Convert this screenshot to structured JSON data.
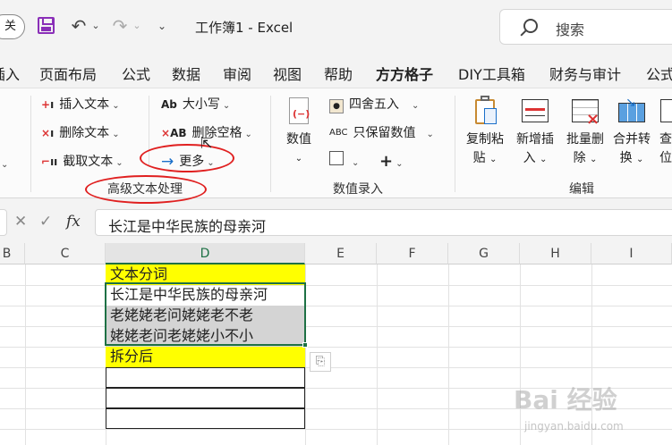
{
  "titlebar": {
    "close_fragment": "关",
    "doc_title": "工作簿1 - Excel",
    "search_placeholder": "搜索"
  },
  "menu": {
    "tabs": [
      {
        "label": "插入"
      },
      {
        "label": "页面布局"
      },
      {
        "label": "公式"
      },
      {
        "label": "数据"
      },
      {
        "label": "审阅"
      },
      {
        "label": "视图"
      },
      {
        "label": "帮助"
      },
      {
        "label": "方方格子",
        "active": true
      },
      {
        "label": "DIY工具箱"
      },
      {
        "label": "财务与审计"
      },
      {
        "label": "公式"
      }
    ]
  },
  "ribbon": {
    "text_group": {
      "label": "高级文本处理",
      "insert_text": "插入文本",
      "delete_text": "删除文本",
      "extract_text": "截取文本",
      "case": "大小写",
      "delete_space": "删除空格",
      "more": "更多",
      "case_icon": "Ab",
      "delete_space_icon": "AB"
    },
    "number_group": {
      "label": "数值录入",
      "value_label": "数值",
      "round": "四舍五入",
      "keep_value": "只保留数值",
      "keep_value_icon": "ABC",
      "plus": "+"
    },
    "edit_group": {
      "label": "编辑",
      "copy_paste": [
        "复制粘",
        "贴"
      ],
      "insert": [
        "新增插",
        "入"
      ],
      "batch_delete": [
        "批量删",
        "除"
      ],
      "merge": [
        "合并转",
        "换"
      ],
      "find_fragment": [
        "查",
        "位"
      ]
    }
  },
  "formula_bar": {
    "fx_label": "fx",
    "content": "长江是中华民族的母亲河"
  },
  "sheet": {
    "columns": [
      "B",
      "C",
      "D",
      "E",
      "F",
      "G",
      "H",
      "I"
    ],
    "selected_column": "D",
    "cells": [
      {
        "text": "文本分词",
        "style": "yellow"
      },
      {
        "text": "长江是中华民族的母亲河",
        "style": "white"
      },
      {
        "text": "老姥姥老问姥姥老不老",
        "style": "gray"
      },
      {
        "text": "姥姥老问老姥姥小不小",
        "style": "gray"
      },
      {
        "text": "拆分后",
        "style": "yellow"
      },
      {
        "text": "",
        "style": "bordered"
      },
      {
        "text": "",
        "style": "bordered"
      },
      {
        "text": "",
        "style": "bordered"
      }
    ]
  },
  "watermark": {
    "main": "Bai 经验",
    "sub": "jingyan.baidu.com"
  }
}
